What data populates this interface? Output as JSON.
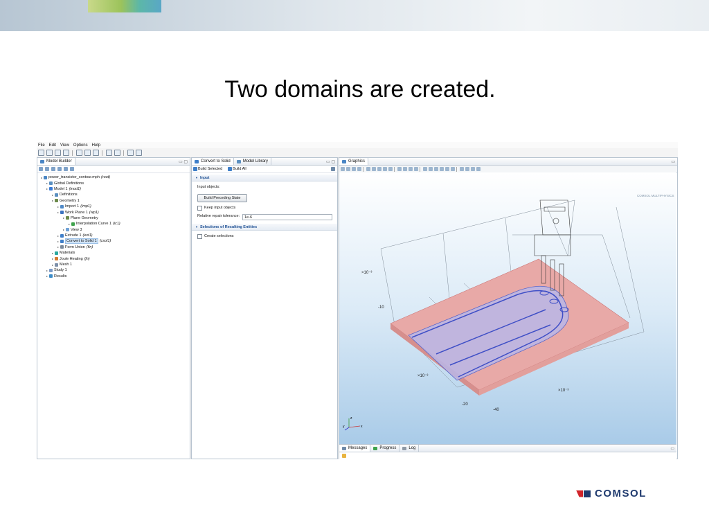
{
  "slide": {
    "title": "Two domains are created."
  },
  "app": {
    "menu": [
      "File",
      "Edit",
      "View",
      "Options",
      "Help"
    ],
    "panels": {
      "model_builder": {
        "tab": "Model Builder",
        "tree": [
          {
            "label": "power_transistor_contour.mph",
            "tag": "(root)",
            "depth": 0,
            "icon_color": "#4a86c5"
          },
          {
            "label": "Global Definitions",
            "tag": "",
            "depth": 1,
            "icon_color": "#5a8fc0"
          },
          {
            "label": "Model 1",
            "tag": "(mod1)",
            "depth": 1,
            "icon_color": "#3a7bd5"
          },
          {
            "label": "Definitions",
            "tag": "",
            "depth": 2,
            "icon_color": "#5a8fc0"
          },
          {
            "label": "Geometry 1",
            "tag": "",
            "depth": 2,
            "icon_color": "#6c8a4a"
          },
          {
            "label": "Import 1",
            "tag": "(imp1)",
            "depth": 3,
            "icon_color": "#4f89c8"
          },
          {
            "label": "Work Plane 1",
            "tag": "(wp1)",
            "depth": 3,
            "icon_color": "#3d74c0"
          },
          {
            "label": "Plane Geometry",
            "tag": "",
            "depth": 4,
            "icon_color": "#6c8a4a"
          },
          {
            "label": "Interpolation Curve 1",
            "tag": "(ic1)",
            "depth": 5,
            "icon_color": "#3fa34d"
          },
          {
            "label": "View 3",
            "tag": "",
            "depth": 4,
            "icon_color": "#6fa1d6"
          },
          {
            "label": "Extrude 1",
            "tag": "(ext1)",
            "depth": 3,
            "icon_color": "#3f7fc9"
          },
          {
            "label": "Convert to Solid 1",
            "tag": "(csol1)",
            "depth": 3,
            "icon_color": "#3f7fc9",
            "selected": true
          },
          {
            "label": "Form Union",
            "tag": "(fin)",
            "depth": 3,
            "icon_color": "#7a8a9c"
          },
          {
            "label": "Materials",
            "tag": "",
            "depth": 2,
            "icon_color": "#2aa8a0"
          },
          {
            "label": "Joule Heating",
            "tag": "(jh)",
            "depth": 2,
            "icon_color": "#d57a2f"
          },
          {
            "label": "Mesh 1",
            "tag": "",
            "depth": 2,
            "icon_color": "#7d8fa8"
          },
          {
            "label": "Study 1",
            "tag": "",
            "depth": 1,
            "icon_color": "#7b9ac7"
          },
          {
            "label": "Results",
            "tag": "",
            "depth": 1,
            "icon_color": "#3c8cc8"
          }
        ]
      },
      "settings": {
        "tabs": [
          "Convert to Solid",
          "Model Library"
        ],
        "build_selected": "Build Selected",
        "build_all": "Build All",
        "sections": {
          "input": {
            "title": "Input",
            "input_objects_label": "Input objects:",
            "build_preceding": "Build Preceding State",
            "keep_input": "Keep input objects",
            "tolerance_label": "Relative repair tolerance:",
            "tolerance_value": "1e-6"
          },
          "selections": {
            "title": "Selections of Resulting Entities",
            "create_selections": "Create selections"
          }
        }
      },
      "graphics": {
        "tab": "Graphics",
        "watermark": "COMSOL MULTIPHYSICS",
        "axis_labels": [
          "×10⁻³",
          "-10",
          "×10⁻³",
          "×10⁻³",
          "-20",
          "-40"
        ],
        "triad": {
          "z": "z",
          "y": "y",
          "x": "x"
        }
      },
      "messages": {
        "tabs": [
          "Messages",
          "Progress",
          "Log"
        ]
      }
    }
  },
  "logo": {
    "text": "COMSOL"
  }
}
